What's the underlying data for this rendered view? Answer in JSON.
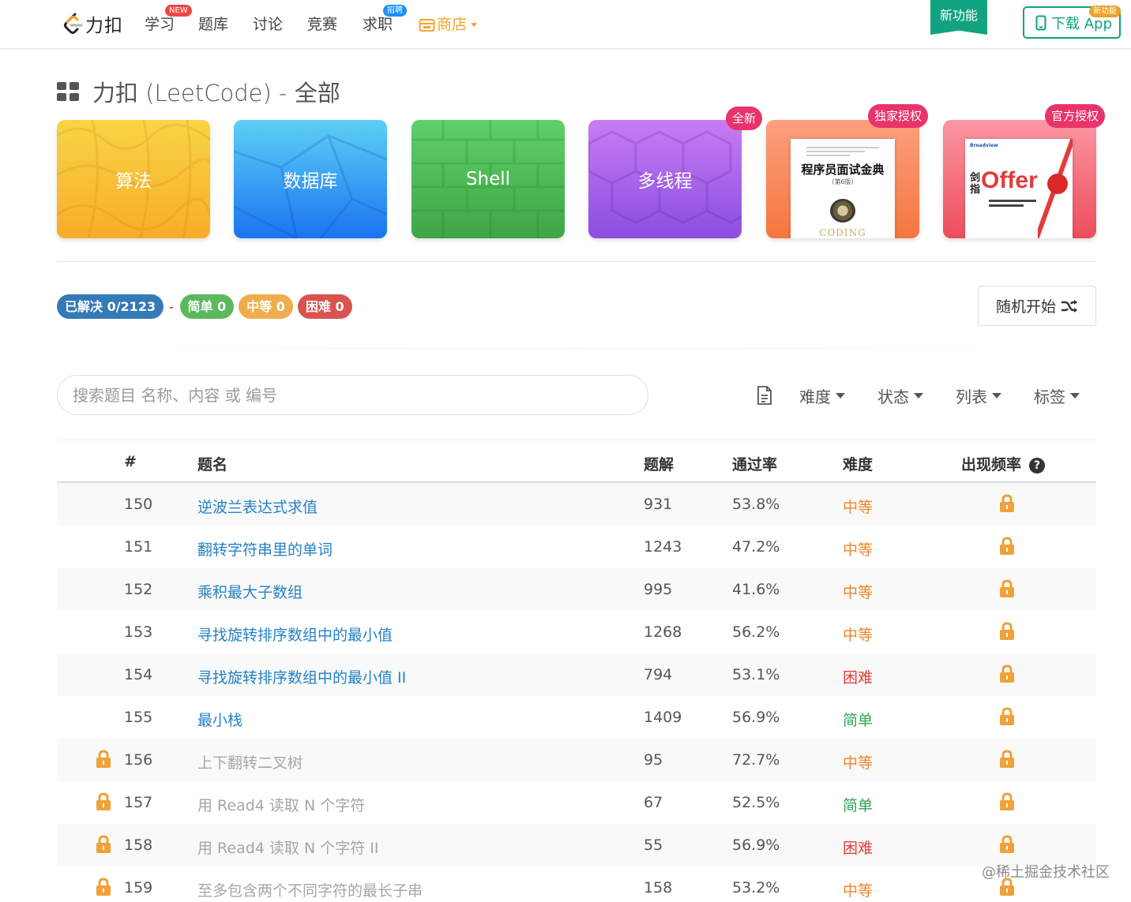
{
  "nav": {
    "logo_text": "力扣",
    "items": [
      {
        "label": "学习",
        "badge": "NEW"
      },
      {
        "label": "题库"
      },
      {
        "label": "讨论"
      },
      {
        "label": "竞赛"
      },
      {
        "label": "求职",
        "badge": "招聘"
      }
    ],
    "store_label": "商店",
    "new_feature_label": "新功能",
    "download_label": "下载 App",
    "download_badge": "新功能"
  },
  "page_title": "力扣 (LeetCode) - 全部",
  "cards": [
    {
      "label": "算法"
    },
    {
      "label": "数据库"
    },
    {
      "label": "Shell"
    },
    {
      "label": "多线程",
      "tag": "全新"
    },
    {
      "tag": "独家授权",
      "book_title": "程序员面试金典",
      "book_subtitle": "（第6版）",
      "book_footer": "CODING"
    },
    {
      "tag": "官方授权",
      "book_title_prefix": "剑指",
      "book_title": "Offer"
    }
  ],
  "progress": {
    "solved_label": "已解决 0/2123",
    "separator": "-",
    "easy_label": "简单 0",
    "medium_label": "中等 0",
    "hard_label": "困难 0"
  },
  "random_button": "随机开始",
  "search": {
    "placeholder": "搜索题目 名称、内容 或 编号"
  },
  "filters": [
    "难度",
    "状态",
    "列表",
    "标签"
  ],
  "table": {
    "headers": {
      "id": "#",
      "title": "题名",
      "solutions": "题解",
      "rate": "通过率",
      "difficulty": "难度",
      "frequency": "出现频率"
    },
    "rows": [
      {
        "id": "150",
        "title": "逆波兰表达式求值",
        "solutions": "931",
        "rate": "53.8%",
        "difficulty": "中等",
        "level": "medium",
        "locked": false
      },
      {
        "id": "151",
        "title": "翻转字符串里的单词",
        "solutions": "1243",
        "rate": "47.2%",
        "difficulty": "中等",
        "level": "medium",
        "locked": false
      },
      {
        "id": "152",
        "title": "乘积最大子数组",
        "solutions": "995",
        "rate": "41.6%",
        "difficulty": "中等",
        "level": "medium",
        "locked": false
      },
      {
        "id": "153",
        "title": "寻找旋转排序数组中的最小值",
        "solutions": "1268",
        "rate": "56.2%",
        "difficulty": "中等",
        "level": "medium",
        "locked": false
      },
      {
        "id": "154",
        "title": "寻找旋转排序数组中的最小值 II",
        "solutions": "794",
        "rate": "53.1%",
        "difficulty": "困难",
        "level": "hard",
        "locked": false
      },
      {
        "id": "155",
        "title": "最小栈",
        "solutions": "1409",
        "rate": "56.9%",
        "difficulty": "简单",
        "level": "easy",
        "locked": false
      },
      {
        "id": "156",
        "title": "上下翻转二叉树",
        "solutions": "95",
        "rate": "72.7%",
        "difficulty": "中等",
        "level": "medium",
        "locked": true
      },
      {
        "id": "157",
        "title": "用 Read4 读取 N 个字符",
        "solutions": "67",
        "rate": "52.5%",
        "difficulty": "简单",
        "level": "easy",
        "locked": true
      },
      {
        "id": "158",
        "title": "用 Read4 读取 N 个字符 II",
        "solutions": "55",
        "rate": "56.9%",
        "difficulty": "困难",
        "level": "hard",
        "locked": true
      },
      {
        "id": "159",
        "title": "至多包含两个不同字符的最长子串",
        "solutions": "158",
        "rate": "53.2%",
        "difficulty": "中等",
        "level": "medium",
        "locked": true
      }
    ]
  },
  "watermark": "@稀土掘金技术社区",
  "colors": {
    "brand_green": "#11a37f",
    "link_blue": "#2482c7",
    "lock_orange": "#f0a13a",
    "medium": "#f0862b",
    "hard": "#e0403a",
    "easy": "#2fa84f"
  }
}
